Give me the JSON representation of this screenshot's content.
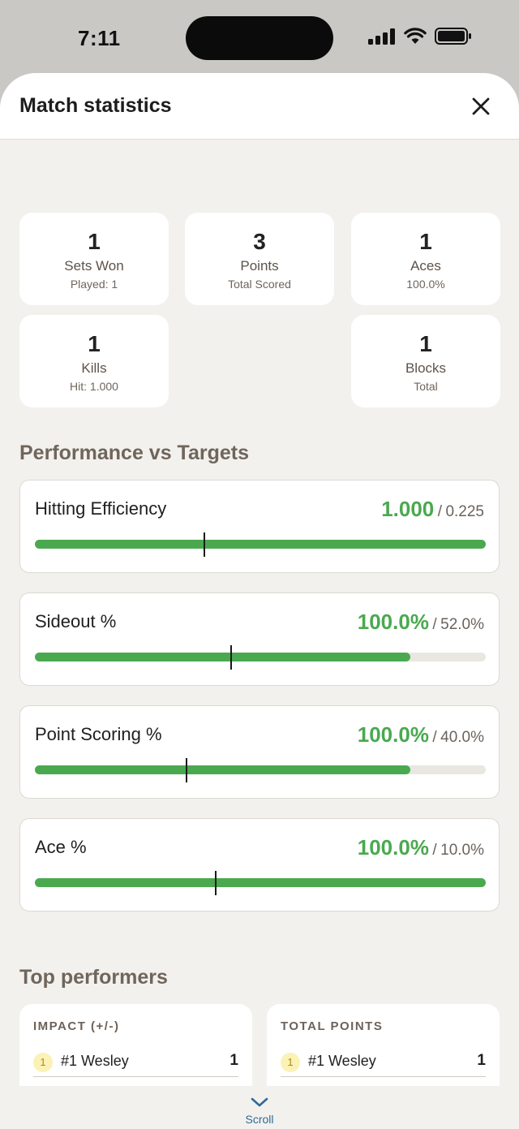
{
  "status_bar": {
    "time": "7:11"
  },
  "header": {
    "title": "Match statistics"
  },
  "stats": [
    {
      "value": "1",
      "label": "Sets Won",
      "sub": "Played: 1"
    },
    {
      "value": "3",
      "label": "Points",
      "sub": "Total Scored"
    },
    {
      "value": "1",
      "label": "Aces",
      "sub": "100.0%"
    },
    {
      "value": "1",
      "label": "Kills",
      "sub": "Hit: 1.000"
    },
    {
      "value": "1",
      "label": "Blocks",
      "sub": "Total"
    }
  ],
  "performance": {
    "title": "Performance vs Targets",
    "metrics": [
      {
        "name": "Hitting Efficiency",
        "value": "1.000",
        "target": "0.225",
        "fill_fraction": 1.0,
        "marker_fraction": 0.375
      },
      {
        "name": "Sideout %",
        "value": "100.0%",
        "target": "52.0%",
        "fill_fraction": 0.833,
        "marker_fraction": 0.436
      },
      {
        "name": "Point Scoring %",
        "value": "100.0%",
        "target": "40.0%",
        "fill_fraction": 0.833,
        "marker_fraction": 0.336
      },
      {
        "name": "Ace %",
        "value": "100.0%",
        "target": "10.0%",
        "fill_fraction": 1.0,
        "marker_fraction": 0.401
      }
    ],
    "separator": "/"
  },
  "top_performers": {
    "title": "Top performers",
    "cards": [
      {
        "header": "IMPACT (+/-)",
        "rank": "1",
        "name": "#1 Wesley",
        "value": "1"
      },
      {
        "header": "TOTAL POINTS",
        "rank": "1",
        "name": "#1 Wesley",
        "value": "1"
      }
    ]
  },
  "footer": {
    "scroll_label": "Scroll"
  },
  "colors": {
    "accent_green": "#4aa94f",
    "footer_blue": "#2f6a9a",
    "badge_yellow": "#fbf2b5"
  },
  "icons": {
    "close": "close-icon",
    "scroll": "chevron-down-icon"
  }
}
